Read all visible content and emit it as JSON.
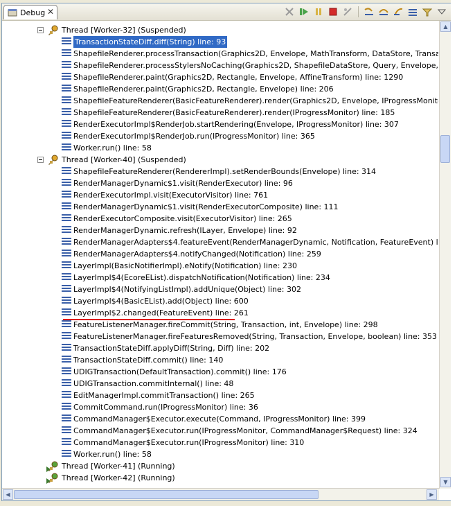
{
  "tab": {
    "label": "Debug",
    "close": "✕"
  },
  "toolbar": {
    "icons": [
      "remove-terminated-icon",
      "resume-icon",
      "suspend-icon",
      "terminate-icon",
      "disconnect-icon",
      "step-into-icon",
      "step-over-icon",
      "step-return-icon",
      "drop-to-frame-icon",
      "use-step-filters-icon",
      "view-menu-icon"
    ]
  },
  "threads": [
    {
      "label": "Thread [Worker-32] (Suspended)",
      "state": "suspended",
      "frames": [
        "TransactionStateDiff.diff(String) line: 93",
        "ShapefileRenderer.processTransaction(Graphics2D, Envelope, MathTransform, DataStore, Transaction, Strin",
        "ShapefileRenderer.processStylersNoCaching(Graphics2D, ShapefileDataStore, Query, Envelope, MathTransfo",
        "ShapefileRenderer.paint(Graphics2D, Rectangle, Envelope, AffineTransform) line: 1290",
        "ShapefileRenderer.paint(Graphics2D, Rectangle, Envelope) line: 206",
        "ShapefileFeatureRenderer(BasicFeatureRenderer).render(Graphics2D, Envelope, IProgressMonitor) line: 261",
        "ShapefileFeatureRenderer(BasicFeatureRenderer).render(IProgressMonitor) line: 185",
        "RenderExecutorImpl$RenderJob.startRendering(Envelope, IProgressMonitor) line: 307",
        "RenderExecutorImpl$RenderJob.run(IProgressMonitor) line: 365",
        "Worker.run() line: 58"
      ]
    },
    {
      "label": "Thread [Worker-40] (Suspended)",
      "state": "suspended",
      "frames": [
        "ShapefileFeatureRenderer(RendererImpl).setRenderBounds(Envelope) line: 314",
        "RenderManagerDynamic$1.visit(RenderExecutor) line: 96",
        "RenderExecutorImpl.visit(ExecutorVisitor) line: 761",
        "RenderManagerDynamic$1.visit(RenderExecutorComposite) line: 111",
        "RenderExecutorComposite.visit(ExecutorVisitor) line: 265",
        "RenderManagerDynamic.refresh(ILayer, Envelope) line: 92",
        "RenderManagerAdapters$4.featureEvent(RenderManagerDynamic, Notification, FeatureEvent) line: 291",
        "RenderManagerAdapters$4.notifyChanged(Notification) line: 259",
        "LayerImpl(BasicNotifierImpl).eNotify(Notification) line: 230",
        "LayerImpl$4(EcoreEList).dispatchNotification(Notification) line: 234",
        "LayerImpl$4(NotifyingListImpl).addUnique(Object) line: 302",
        "LayerImpl$4(BasicEList).add(Object) line: 600",
        "LayerImpl$2.changed(FeatureEvent) line: 261",
        "FeatureListenerManager.fireCommit(String, Transaction, int, Envelope) line: 298",
        "FeatureListenerManager.fireFeaturesRemoved(String, Transaction, Envelope, boolean) line: 353",
        "TransactionStateDiff.applyDiff(String, Diff) line: 202",
        "TransactionStateDiff.commit() line: 140",
        "UDIGTransaction(DefaultTransaction).commit() line: 176",
        "UDIGTransaction.commitInternal() line: 48",
        "EditManagerImpl.commitTransaction() line: 265",
        "CommitCommand.run(IProgressMonitor) line: 36",
        "CommandManager$Executor.execute(Command, IProgressMonitor) line: 399",
        "CommandManager$Executor.run(IProgressMonitor, CommandManager$Request) line: 324",
        "CommandManager$Executor.run(IProgressMonitor) line: 310",
        "Worker.run() line: 58"
      ]
    },
    {
      "label": "Thread [Worker-41] (Running)",
      "state": "running",
      "frames": []
    },
    {
      "label": "Thread [Worker-42] (Running)",
      "state": "running",
      "frames": []
    }
  ],
  "selected_frame": "TransactionStateDiff.diff(String) line: 93",
  "highlighted_frame": "LayerImpl$2.changed(FeatureEvent) line: 261",
  "colors": {
    "selection": "#316ac5",
    "frame_icon": "#3a5fa8",
    "highlight_line": "#dd0000"
  }
}
